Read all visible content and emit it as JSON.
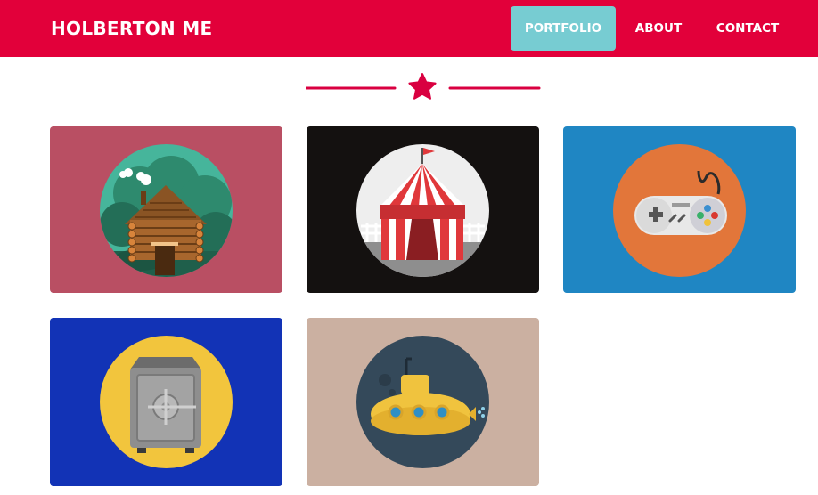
{
  "navbar": {
    "brand": "HOLBERTON ME",
    "links": [
      {
        "label": "PORTFOLIO",
        "active": true
      },
      {
        "label": "ABOUT",
        "active": false
      },
      {
        "label": "CONTACT",
        "active": false
      }
    ],
    "color": "#e2003a",
    "active_color": "#77ccd2"
  },
  "divider": {
    "icon": "star-icon",
    "color": "#d90040"
  },
  "portfolio": {
    "items": [
      {
        "icon": "cabin-icon",
        "background": "#b94f63"
      },
      {
        "icon": "circus-tent-icon",
        "background": "#141110"
      },
      {
        "icon": "game-controller-icon",
        "background": "#1f86c3"
      },
      {
        "icon": "safe-icon",
        "background": "#1233b6"
      },
      {
        "icon": "submarine-icon",
        "background": "#cbb0a1"
      }
    ]
  }
}
